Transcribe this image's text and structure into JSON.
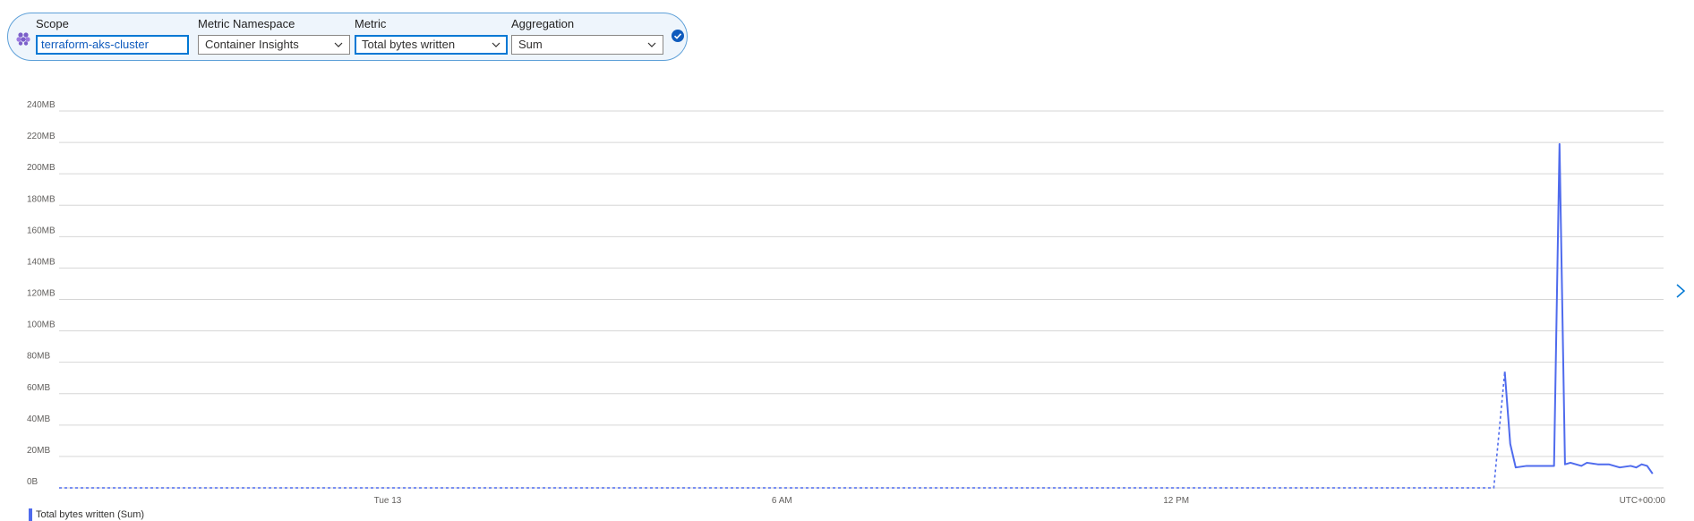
{
  "metric_picker": {
    "scope_label": "Scope",
    "scope_value": "terraform-aks-cluster",
    "namespace_label": "Metric Namespace",
    "namespace_value": "Container Insights",
    "metric_label": "Metric",
    "metric_value": "Total bytes written",
    "aggregation_label": "Aggregation",
    "aggregation_value": "Sum",
    "scope_icon": "kubernetes-cluster-icon",
    "confirm_icon": "checkmark-circle-icon",
    "accent_color": "#0078d4"
  },
  "chart_data": {
    "type": "line",
    "y_ticks": [
      "240MB",
      "220MB",
      "200MB",
      "180MB",
      "160MB",
      "140MB",
      "120MB",
      "100MB",
      "80MB",
      "60MB",
      "40MB",
      "20MB",
      "0B"
    ],
    "ylim": [
      0,
      240
    ],
    "x_ticks": [
      "Tue 13",
      "6 AM",
      "12 PM"
    ],
    "timezone_label": "UTC+00:00",
    "grid": true,
    "series": [
      {
        "name": "Total bytes written (Sum)",
        "color": "#4f6bed",
        "dashed_until_index": 1,
        "points": [
          {
            "x": "Mon 12 19:00",
            "y": 0
          },
          {
            "x": "Tue 13 16:50",
            "y": 0
          },
          {
            "x": "Tue 13 17:00",
            "y": 74
          },
          {
            "x": "Tue 13 17:05",
            "y": 28
          },
          {
            "x": "Tue 13 17:10",
            "y": 13
          },
          {
            "x": "Tue 13 17:20",
            "y": 14
          },
          {
            "x": "Tue 13 17:30",
            "y": 14
          },
          {
            "x": "Tue 13 17:40",
            "y": 14
          },
          {
            "x": "Tue 13 17:45",
            "y": 14
          },
          {
            "x": "Tue 13 17:50",
            "y": 219
          },
          {
            "x": "Tue 13 17:55",
            "y": 15
          },
          {
            "x": "Tue 13 18:00",
            "y": 16
          },
          {
            "x": "Tue 13 18:10",
            "y": 14
          },
          {
            "x": "Tue 13 18:15",
            "y": 16
          },
          {
            "x": "Tue 13 18:25",
            "y": 15
          },
          {
            "x": "Tue 13 18:35",
            "y": 15
          },
          {
            "x": "Tue 13 18:45",
            "y": 13
          },
          {
            "x": "Tue 13 18:55",
            "y": 14
          },
          {
            "x": "Tue 13 19:00",
            "y": 13
          },
          {
            "x": "Tue 13 19:05",
            "y": 15
          },
          {
            "x": "Tue 13 19:10",
            "y": 14
          },
          {
            "x": "Tue 13 19:15",
            "y": 9
          }
        ]
      }
    ]
  },
  "legend": {
    "label": "Total bytes written (Sum)"
  },
  "next_icon": "chevron-right-icon"
}
